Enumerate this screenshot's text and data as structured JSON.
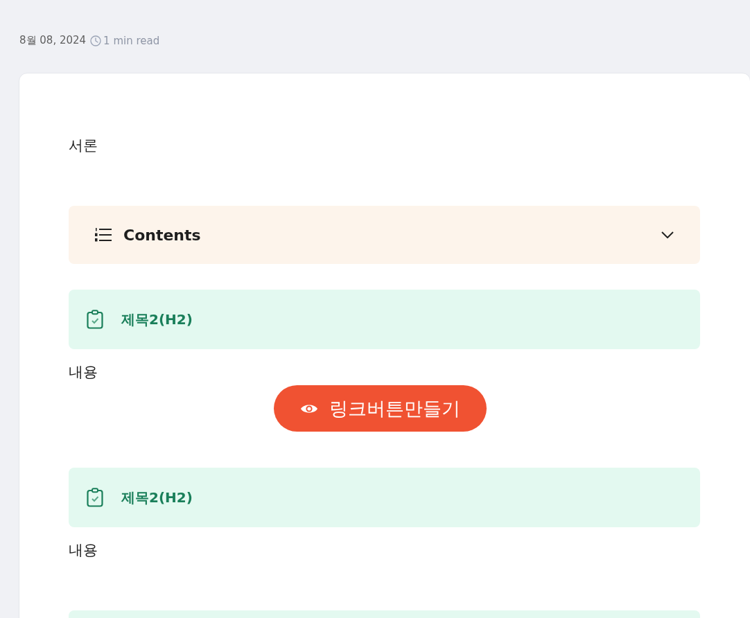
{
  "meta": {
    "date": "8월 08, 2024",
    "read_time": "1 min read"
  },
  "blocks": [
    {
      "kind": "paragraph",
      "text": "서론"
    },
    {
      "kind": "toc",
      "title": "Contents",
      "expanded": false
    },
    {
      "kind": "heading",
      "text": "제목2(H2)"
    },
    {
      "kind": "paragraph",
      "text": "내용"
    },
    {
      "kind": "button",
      "label": "링크버튼만들기"
    },
    {
      "kind": "heading",
      "text": "제목2(H2)"
    },
    {
      "kind": "paragraph",
      "text": "내용"
    },
    {
      "kind": "heading"
    }
  ]
}
